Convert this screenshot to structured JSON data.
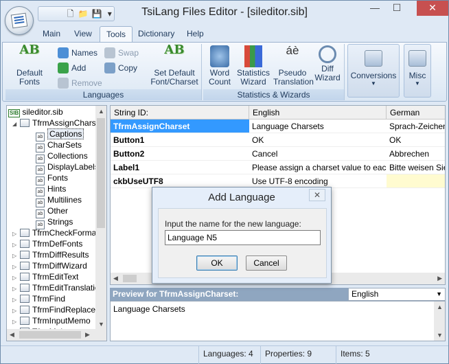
{
  "app": {
    "title": "TsiLang Files Editor - [sileditor.sib]"
  },
  "quick_access": {
    "dropdown": "▾"
  },
  "window_controls": {
    "minimize": "—",
    "maximize": "☐",
    "close": "✕"
  },
  "tabs": [
    "Main",
    "View",
    "Tools",
    "Dictionary",
    "Help"
  ],
  "active_tab": "Tools",
  "ribbon": {
    "languages": {
      "label": "Languages",
      "default_fonts": "Default Fonts",
      "names": "Names",
      "add": "Add",
      "remove": "Remove",
      "swap": "Swap",
      "copy": "Copy",
      "set_default": "Set Default Font/Charset"
    },
    "stats": {
      "label": "Statistics & Wizards",
      "word_count": "Word Count",
      "statistics_wizard": "Statistics Wizard",
      "pseudo_translation": "Pseudo Translation",
      "diff_wizard": "Diff Wizard"
    },
    "conversions": "Conversions",
    "misc": "Misc"
  },
  "tree": {
    "root": "sileditor.sib",
    "expanded": "TfrmAssignCharset",
    "children": [
      "Captions",
      "CharSets",
      "Collections",
      "DisplayLabels",
      "Fonts",
      "Hints",
      "Multilines",
      "Other",
      "Strings"
    ],
    "selected_child": "Captions",
    "others": [
      "TfrmCheckFormat",
      "TfrmDefFonts",
      "TfrmDiffResults",
      "TfrmDiffWizard",
      "TfrmEditText",
      "TfrmEditTranslation",
      "TfrmFind",
      "TfrmFindReplaceC",
      "TfrmInputMemo",
      "TfrmMain"
    ]
  },
  "grid": {
    "headers": [
      "String ID:",
      "English",
      "German"
    ],
    "rows": [
      {
        "id": "TfrmAssignCharset",
        "english": "Language Charsets",
        "german": "Sprach-Zeichensätze"
      },
      {
        "id": "Button1",
        "english": "OK",
        "german": "OK"
      },
      {
        "id": "Button2",
        "english": "Cancel",
        "german": "Abbrechen"
      },
      {
        "id": "Label1",
        "english": "Please assign a charset value to each of the",
        "german": "Bitte weisen Sie jeder"
      },
      {
        "id": "ckbUseUTF8",
        "english": "Use UTF-8 encoding",
        "german": ""
      }
    ]
  },
  "preview": {
    "title": "Preview for TfrmAssignCharset:",
    "language": "English",
    "text": "Language Charsets"
  },
  "status": {
    "languages": "Languages: 4",
    "properties": "Properties: 9",
    "items": "Items: 5"
  },
  "dialog": {
    "title": "Add Language",
    "prompt": "Input the name for the new language:",
    "value": "Language N5",
    "ok": "OK",
    "cancel": "Cancel"
  },
  "colors": {
    "selection": "#3399ff",
    "ribbon_label": "#1e395b",
    "close": "#c75050"
  }
}
